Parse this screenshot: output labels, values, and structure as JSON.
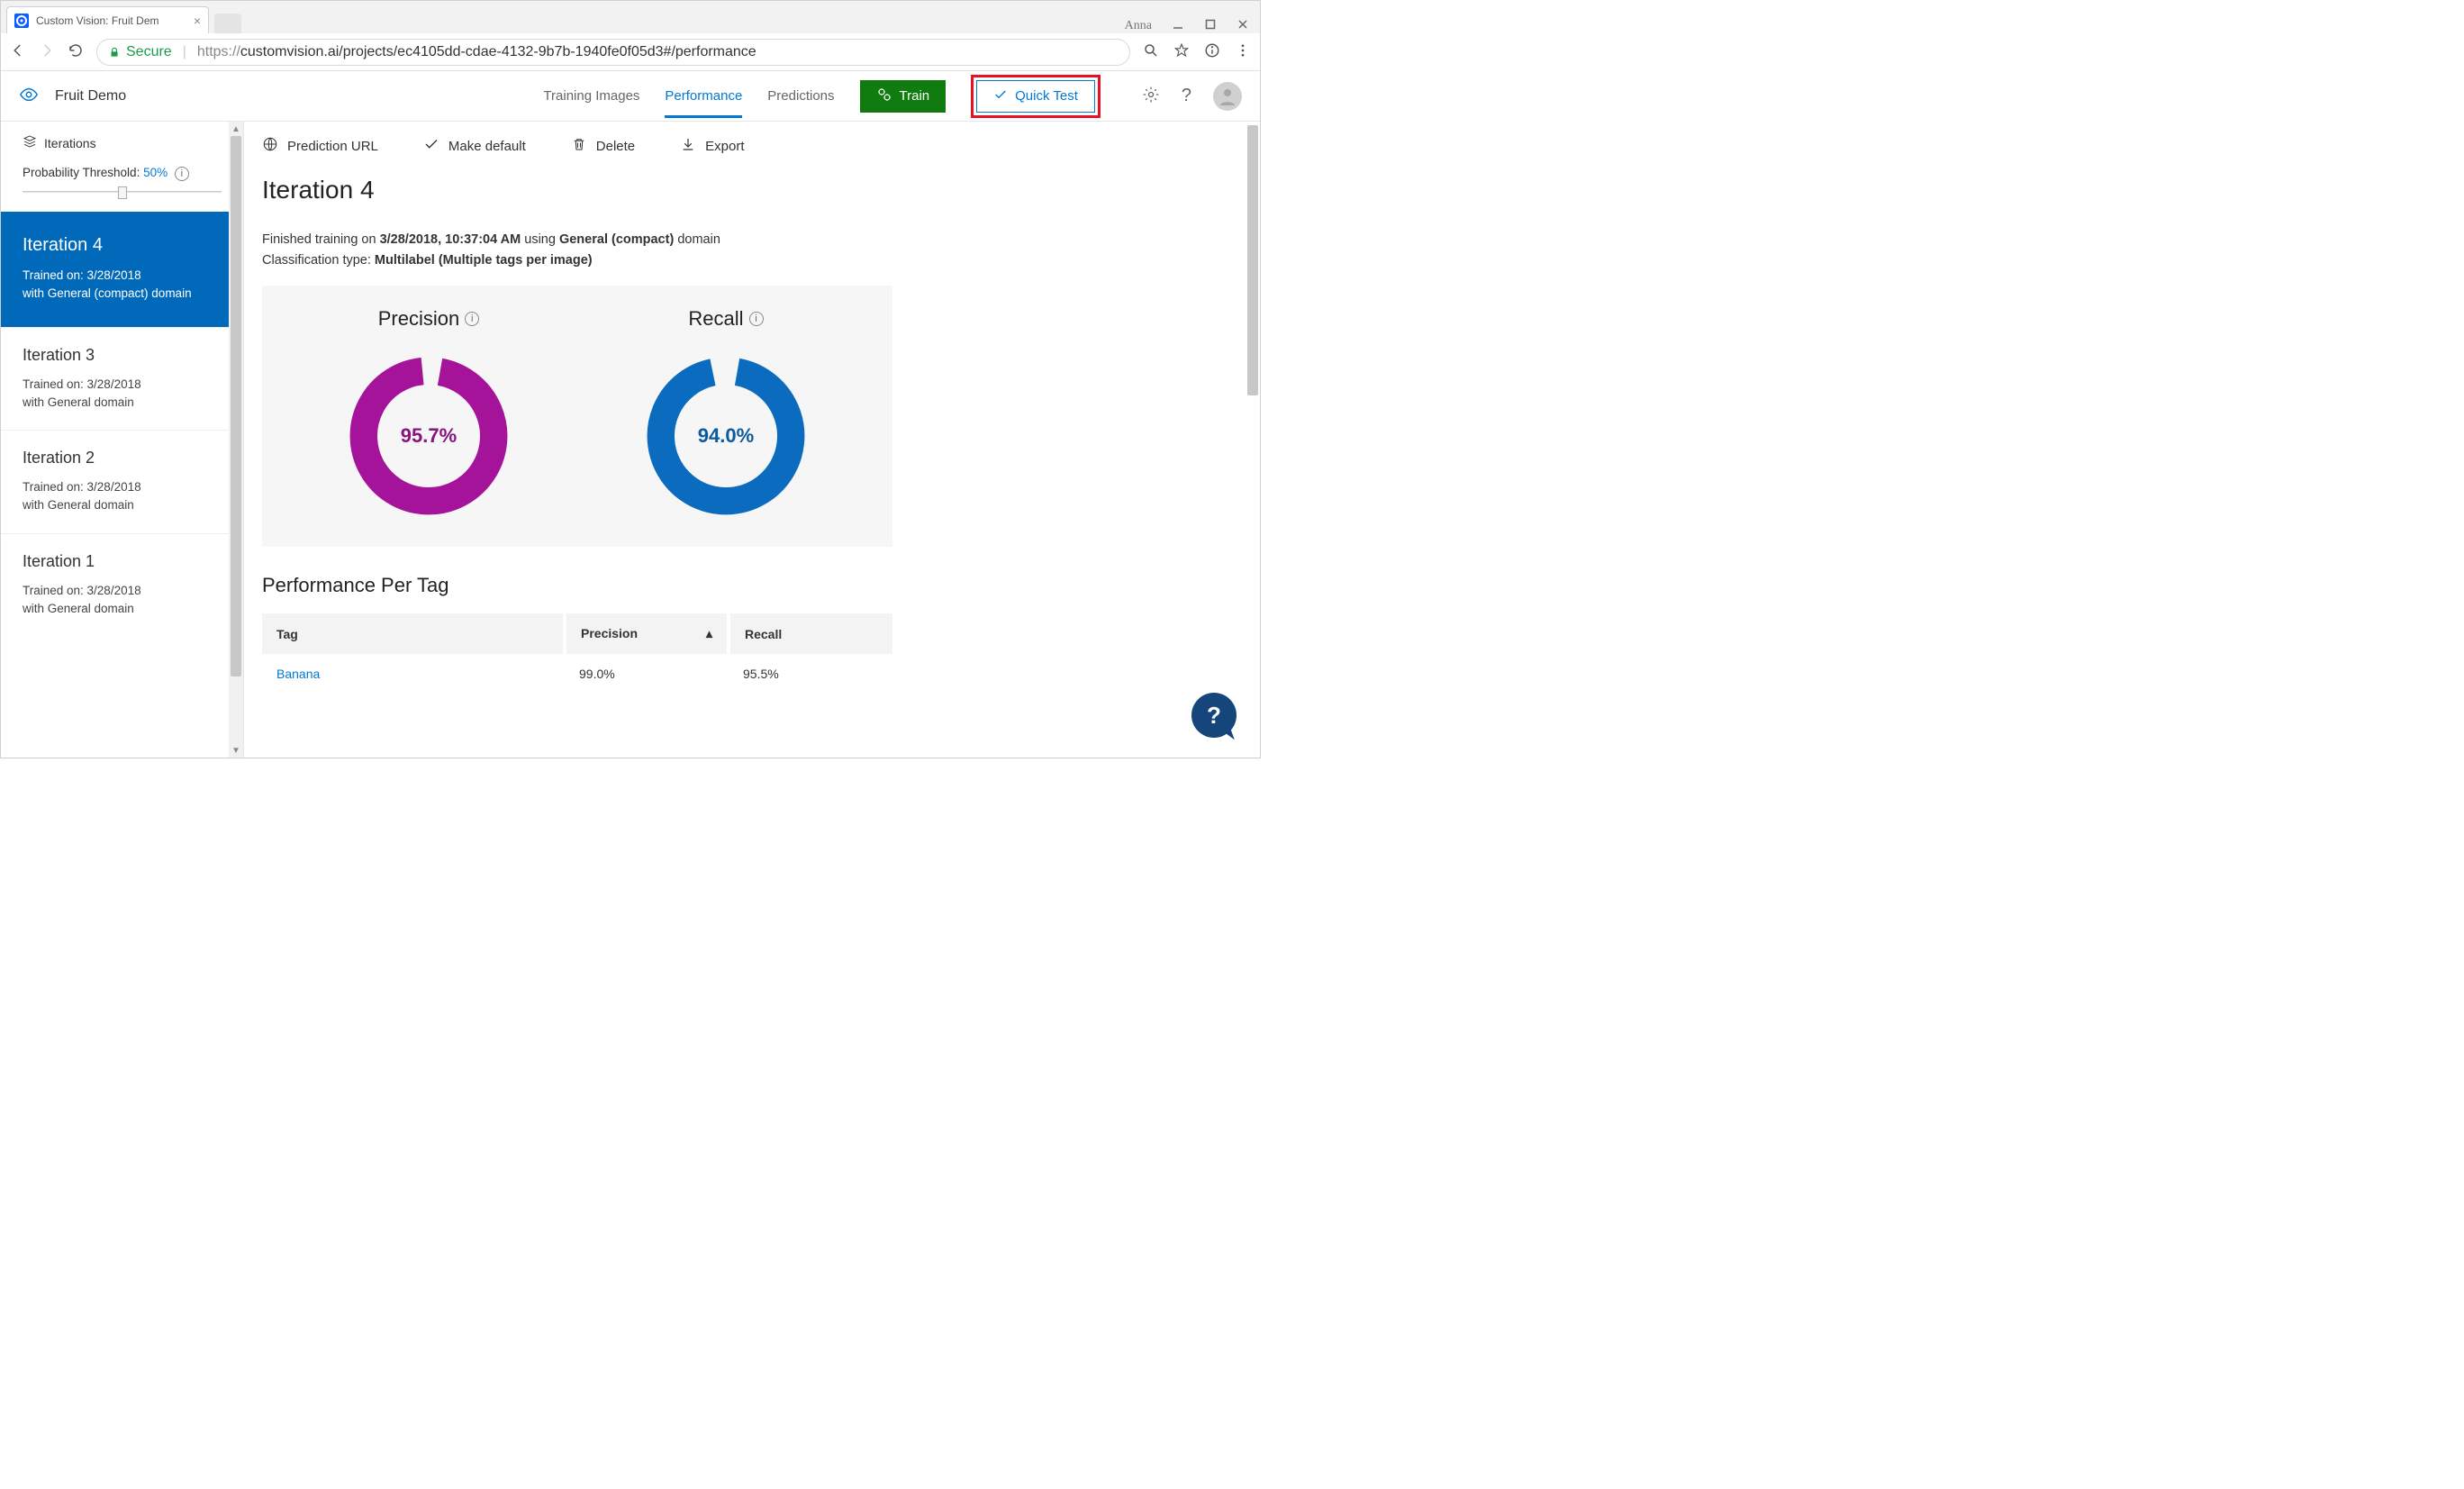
{
  "browser": {
    "tab_title": "Custom Vision: Fruit Dem",
    "user": "Anna",
    "secure_label": "Secure",
    "url_proto": "https://",
    "url_rest": "customvision.ai/projects/ec4105dd-cdae-4132-9b7b-1940fe0f05d3#/performance"
  },
  "header": {
    "project": "Fruit Demo",
    "nav": {
      "training_images": "Training Images",
      "performance": "Performance",
      "predictions": "Predictions"
    },
    "train_btn": "Train",
    "quick_test_btn": "Quick Test"
  },
  "sidebar": {
    "iterations_label": "Iterations",
    "threshold_label": "Probability Threshold: ",
    "threshold_value": "50%",
    "items": [
      {
        "title": "Iteration 4",
        "line1": "Trained on: 3/28/2018",
        "line2": "with General (compact) domain"
      },
      {
        "title": "Iteration 3",
        "line1": "Trained on: 3/28/2018",
        "line2": "with General domain"
      },
      {
        "title": "Iteration 2",
        "line1": "Trained on: 3/28/2018",
        "line2": "with General domain"
      },
      {
        "title": "Iteration 1",
        "line1": "Trained on: 3/28/2018",
        "line2": "with General domain"
      }
    ]
  },
  "toolbar": {
    "prediction_url": "Prediction URL",
    "make_default": "Make default",
    "delete": "Delete",
    "export": "Export"
  },
  "main": {
    "title": "Iteration 4",
    "line1_a": "Finished training on ",
    "line1_b": "3/28/2018, 10:37:04 AM",
    "line1_c": " using ",
    "line1_d": "General (compact)",
    "line1_e": " domain",
    "line2_a": "Classification type: ",
    "line2_b": "Multilabel (Multiple tags per image)",
    "precision_label": "Precision",
    "recall_label": "Recall",
    "ppt_title": "Performance Per Tag",
    "cols": {
      "tag": "Tag",
      "precision": "Precision",
      "recall": "Recall"
    },
    "rows": [
      {
        "tag": "Banana",
        "precision": "99.0%",
        "recall": "95.5%"
      }
    ]
  },
  "chart_data": [
    {
      "type": "pie",
      "title": "Precision",
      "value": 95.7,
      "display": "95.7%",
      "color": "#a4139a"
    },
    {
      "type": "pie",
      "title": "Recall",
      "value": 94.0,
      "display": "94.0%",
      "color": "#0b6cbf"
    }
  ]
}
